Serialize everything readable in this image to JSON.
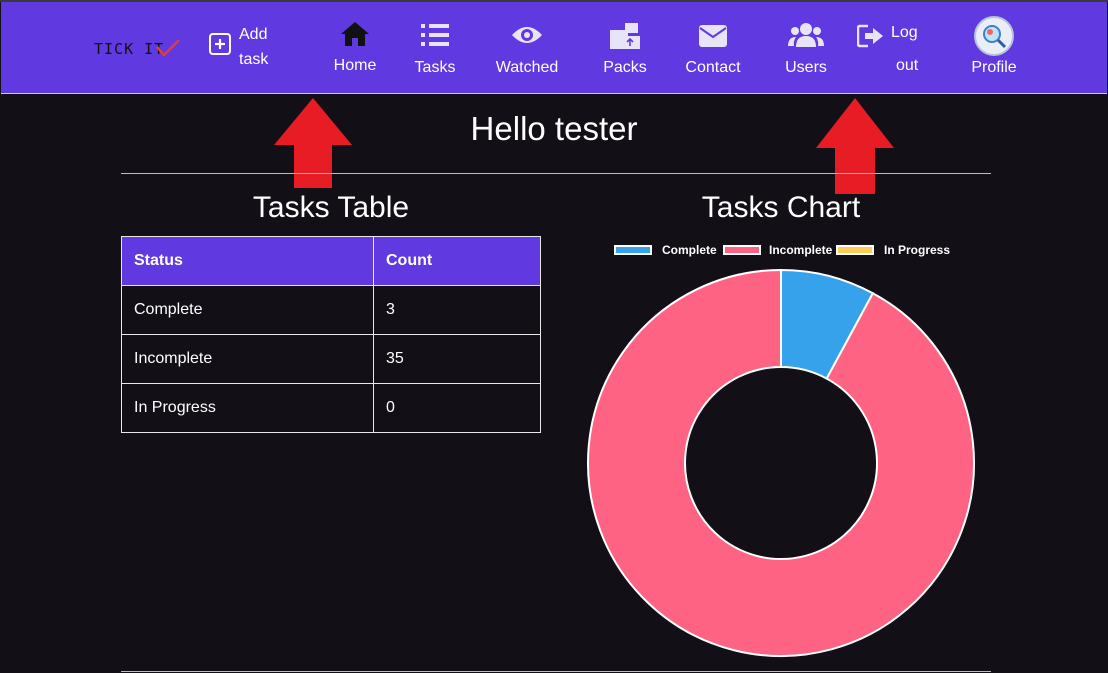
{
  "brand": {
    "name": "TICK IT"
  },
  "nav": {
    "add_task_line1": "Add",
    "add_task_line2": "task",
    "home": "Home",
    "tasks": "Tasks",
    "watched": "Watched",
    "packs": "Packs",
    "contact": "Contact",
    "users": "Users",
    "logout_line1": "Log",
    "logout_line2": "out",
    "profile": "Profile"
  },
  "greeting": "Hello tester",
  "table": {
    "title": "Tasks Table",
    "headers": [
      "Status",
      "Count"
    ],
    "rows": [
      [
        "Complete",
        "3"
      ],
      [
        "Incomplete",
        "35"
      ],
      [
        "In Progress",
        "0"
      ]
    ]
  },
  "chart_title": "Tasks Chart",
  "colors": {
    "navbar": "#6039e1",
    "complete": "#36a2eb",
    "incomplete": "#ff6384",
    "in_progress": "#ffcd56",
    "annotation_arrow": "#e81c24"
  },
  "chart_data": {
    "type": "pie",
    "variant": "doughnut",
    "categories": [
      "Complete",
      "Incomplete",
      "In Progress"
    ],
    "values": [
      3,
      35,
      0
    ],
    "colors": [
      "#36a2eb",
      "#ff6384",
      "#ffcd56"
    ],
    "legend": "top"
  }
}
